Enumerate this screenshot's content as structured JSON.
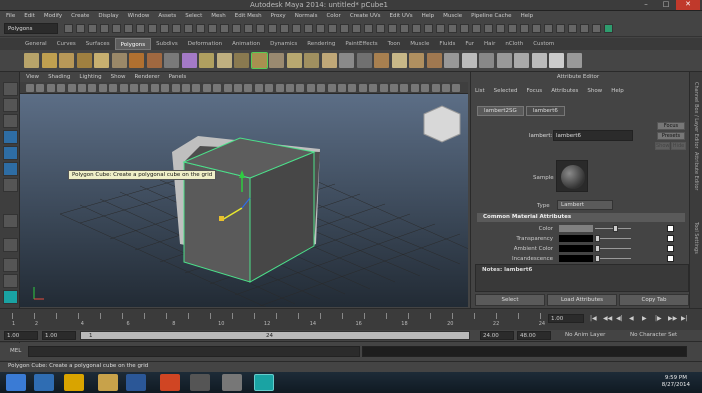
{
  "window": {
    "title": "Autodesk Maya 2014: untitled*    pCube1"
  },
  "menubar": [
    "File",
    "Edit",
    "Modify",
    "Create",
    "Display",
    "Window",
    "Assets",
    "Select",
    "Mesh",
    "Edit Mesh",
    "Proxy",
    "Normals",
    "Color",
    "Create UVs",
    "Edit UVs",
    "Help",
    "Muscle",
    "Pipeline Cache",
    "Help"
  ],
  "status_line": {
    "mode": "Polygons"
  },
  "shelf_tabs": [
    "General",
    "Curves",
    "Surfaces",
    "Polygons",
    "Subdivs",
    "Deformation",
    "Animation",
    "Dynamics",
    "Rendering",
    "PaintEffects",
    "Toon",
    "Muscle",
    "Fluids",
    "Fur",
    "Hair",
    "nCloth",
    "Custom"
  ],
  "shelf_active": "Polygons",
  "panel_menu": [
    "View",
    "Shading",
    "Lighting",
    "Show",
    "Renderer",
    "Panels"
  ],
  "tooltip": "Polygon Cube: Create a polygonal cube on the grid",
  "attribute_editor": {
    "title": "Attribute Editor",
    "menu": [
      "List",
      "Selected",
      "Focus",
      "Attributes",
      "Show",
      "Help"
    ],
    "tabs": [
      "lambert2SG",
      "lambert6"
    ],
    "name_label": "lambert:",
    "name_value": "lambert6",
    "buttons": {
      "focus": "Focus",
      "presets": "Presets",
      "show": "Show",
      "hide": "Hide"
    },
    "sample_label": "Sample",
    "type_label": "Type",
    "type_value": "Lambert",
    "section": "Common Material Attributes",
    "attributes": [
      {
        "label": "Color",
        "swatch": "#808080",
        "knob": 0.5
      },
      {
        "label": "Transparency",
        "swatch": "#000000",
        "knob": 0.0
      },
      {
        "label": "Ambient Color",
        "swatch": "#000000",
        "knob": 0.0
      },
      {
        "label": "Incandescence",
        "swatch": "#000000",
        "knob": 0.0
      }
    ],
    "notes_label": "Notes: lambert6",
    "bottom_buttons": [
      "Select",
      "Load Attributes",
      "Copy Tab"
    ],
    "side_tabs": [
      "Channel Box / Layer Editor",
      "Attribute Editor",
      "Tool Settings"
    ]
  },
  "timeslider": {
    "labels": [
      "1",
      "2",
      "4",
      "6",
      "8",
      "10",
      "12",
      "14",
      "16",
      "18",
      "20",
      "22",
      "24"
    ],
    "current": "1.00"
  },
  "range": {
    "start": "1.00",
    "inner_start": "1.00",
    "bar_left": "1",
    "bar_right": "24",
    "end_inner": "24.00",
    "end": "48.00",
    "anim_layer": "No Anim Layer",
    "char_set": "No Character Set"
  },
  "cmdline": {
    "label": "MEL"
  },
  "helpline": "Polygon Cube: Create a polygonal cube on the grid",
  "taskbar": {
    "time": "9:59 PM",
    "date": "8/27/2014"
  }
}
